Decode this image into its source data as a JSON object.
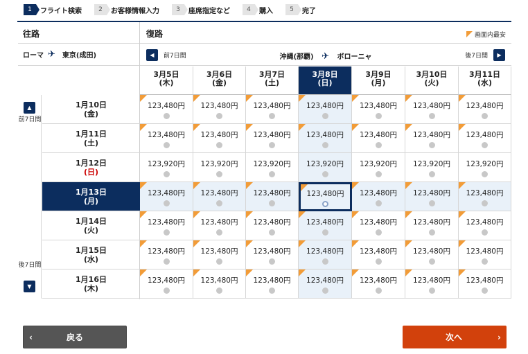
{
  "steps": [
    {
      "num": "1",
      "label": "フライト検索",
      "active": true
    },
    {
      "num": "2",
      "label": "お客様情報入力",
      "active": false
    },
    {
      "num": "3",
      "label": "座席指定など",
      "active": false
    },
    {
      "num": "4",
      "label": "購入",
      "active": false
    },
    {
      "num": "5",
      "label": "完了",
      "active": false
    }
  ],
  "outbound": {
    "title": "往路",
    "from": "ローマ",
    "to": "東京(成田)",
    "prev_label": "前7日間",
    "next_label": "後7日間",
    "dates": [
      {
        "date": "1月10日",
        "day": "(金)",
        "holiday": false
      },
      {
        "date": "1月11日",
        "day": "(土)",
        "holiday": false
      },
      {
        "date": "1月12日",
        "day": "(日)",
        "holiday": true
      },
      {
        "date": "1月13日",
        "day": "(月)",
        "holiday": false
      },
      {
        "date": "1月14日",
        "day": "(火)",
        "holiday": false
      },
      {
        "date": "1月15日",
        "day": "(水)",
        "holiday": false
      },
      {
        "date": "1月16日",
        "day": "(木)",
        "holiday": false
      }
    ],
    "selected_index": 3
  },
  "return": {
    "title": "復路",
    "cheapest_legend": "画面内最安",
    "prev_label": "前7日間",
    "next_label": "後7日間",
    "from": "沖縄(那覇)",
    "to": "ボローニャ",
    "dates": [
      {
        "date": "3月5日",
        "day": "(木)"
      },
      {
        "date": "3月6日",
        "day": "(金)"
      },
      {
        "date": "3月7日",
        "day": "(土)"
      },
      {
        "date": "3月8日",
        "day": "(日)"
      },
      {
        "date": "3月9日",
        "day": "(月)"
      },
      {
        "date": "3月10日",
        "day": "(火)"
      },
      {
        "date": "3月11日",
        "day": "(水)"
      }
    ],
    "selected_index": 3
  },
  "fares": [
    [
      "123,480円",
      "123,480円",
      "123,480円",
      "123,480円",
      "123,480円",
      "123,480円",
      "123,480円"
    ],
    [
      "123,480円",
      "123,480円",
      "123,480円",
      "123,480円",
      "123,480円",
      "123,480円",
      "123,480円"
    ],
    [
      "123,920円",
      "123,920円",
      "123,920円",
      "123,920円",
      "123,920円",
      "123,920円",
      "123,920円"
    ],
    [
      "123,480円",
      "123,480円",
      "123,480円",
      "123,480円",
      "123,480円",
      "123,480円",
      "123,480円"
    ],
    [
      "123,480円",
      "123,480円",
      "123,480円",
      "123,480円",
      "123,480円",
      "123,480円",
      "123,480円"
    ],
    [
      "123,480円",
      "123,480円",
      "123,480円",
      "123,480円",
      "123,480円",
      "123,480円",
      "123,480円"
    ],
    [
      "123,480円",
      "123,480円",
      "123,480円",
      "123,480円",
      "123,480円",
      "123,480円",
      "123,480円"
    ]
  ],
  "cheapest_rows": [
    0,
    1,
    3,
    4,
    5,
    6
  ],
  "buttons": {
    "back": "戻る",
    "next": "次へ"
  },
  "colors": {
    "navy": "#0c2d5e",
    "accent_orange": "#f29c38",
    "next_button": "#d2410c",
    "back_button": "#555555",
    "cell_bg": "#e9f1f9"
  }
}
